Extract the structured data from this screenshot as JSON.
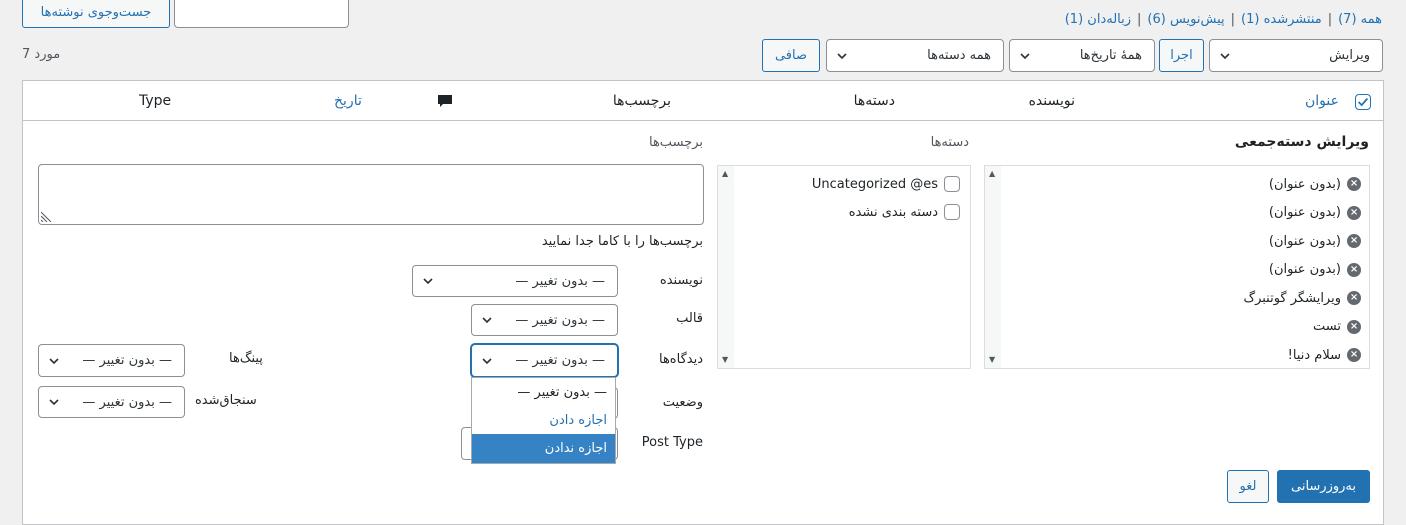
{
  "subsubsub": {
    "all": "همه (7)",
    "published": "منتشرشده (1)",
    "drafts": "پیش‌نویس (6)",
    "trash": "زباله‌دان (1)",
    "sep": "|"
  },
  "search": {
    "value": "",
    "button": "جست‌وجوی نوشته‌ها"
  },
  "toolbar": {
    "bulk_action": "ویرایش",
    "apply": "اجرا",
    "dates": "همهٔ تاریخ‌ها",
    "categories": "همه دسته‌ها",
    "filter": "صافی",
    "count": "7 مورد"
  },
  "table_header": {
    "title": "عنوان",
    "author": "نویسنده",
    "categories": "دسته‌ها",
    "tags": "برچسب‌ها",
    "date": "تاریخ",
    "type": "Type"
  },
  "bulk_edit": {
    "heading": "ویرایش دسته‌جمعی",
    "posts": [
      "(بدون عنوان)",
      "(بدون عنوان)",
      "(بدون عنوان)",
      "(بدون عنوان)",
      "ویرایشگر گوتنبرگ",
      "تست",
      "سلام دنیا!"
    ],
    "categories_label": "دسته‌ها",
    "categories": [
      "Uncategorized @es",
      "دسته بندی نشده"
    ],
    "tags_label": "برچسب‌ها",
    "tags_value": "",
    "tags_help": "برچسب‌ها را با کاما جدا نمایید",
    "author_label": "نویسنده",
    "author_value": "— بدون تغییر —",
    "template_label": "قالب",
    "template_value": "— بدون تغییر —",
    "comments_label": "دیدگاه‌ها",
    "comments_value": "— بدون تغییر —",
    "status_label": "وضعیت",
    "post_type_label": "Post Type",
    "pings_label": "پینگ‌ها",
    "pings_value": "— بدون تغییر —",
    "sticky_label": "سنجاق‌شده",
    "sticky_value": "— بدون تغییر —",
    "dropdown_options": [
      "— بدون تغییر —",
      "اجازه دادن",
      "اجازه ندادن"
    ],
    "update_button": "به‌روزرسانی",
    "cancel_button": "لغو"
  },
  "colors": {
    "accent": "#2271b1",
    "highlight": "#3582c4"
  },
  "icons": {
    "remove": "remove-circle-icon",
    "comment": "comment-bubble-icon",
    "chevron": "chevron-down-icon"
  }
}
